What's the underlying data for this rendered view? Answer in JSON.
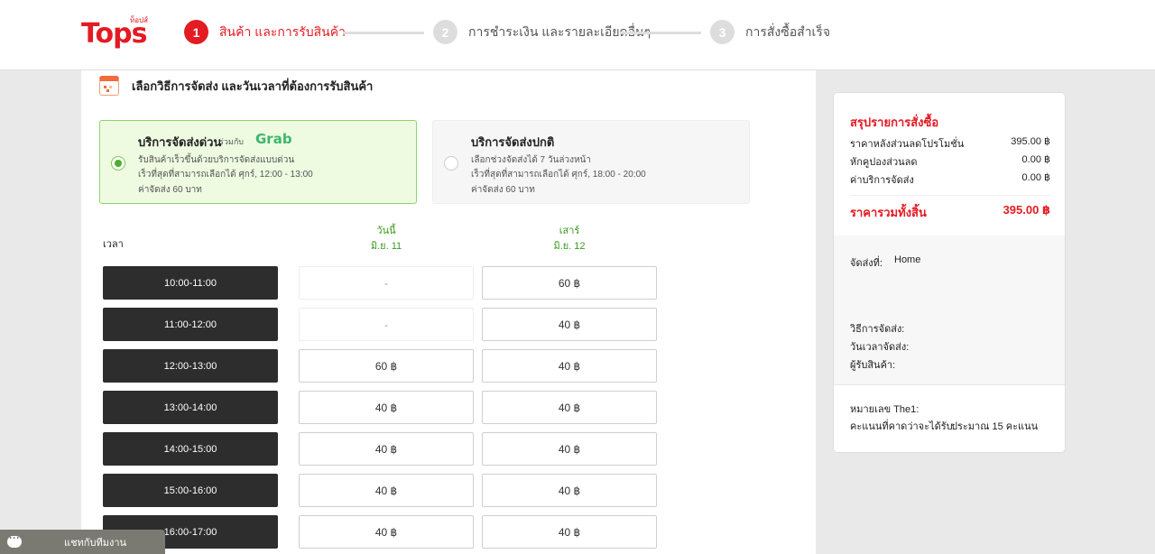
{
  "header": {
    "logo_text": "Tops",
    "logo_tagline": "ท็อปส์",
    "steps": [
      {
        "num": "1",
        "label": "สินค้า และการรับสินค้า"
      },
      {
        "num": "2",
        "label": "การชำระเงิน และรายละเอียดอื่นๆ"
      },
      {
        "num": "3",
        "label": "การสั่งซื้อสำเร็จ"
      }
    ]
  },
  "section_title": "เลือกวิธีการจัดส่ง และวันเวลาที่ต้องการรับสินค้า",
  "delivery_options": [
    {
      "title": "บริการจัดส่งด่วน",
      "partner_label": "ร่วมกับ",
      "partner_name": "Grab",
      "lines": [
        "รับสินค้าเร็วขึ้นด้วยบริการจัดส่งแบบด่วน",
        "เร็วที่สุดที่สามารถเลือกได้ ศุกร์, 12:00 - 13:00",
        "ค่าจัดส่ง 60 บาท"
      ],
      "selected": true
    },
    {
      "title": "บริการจัดส่งปกติ",
      "lines": [
        "เลือกช่วงจัดส่งได้ 7 วันล่วงหน้า",
        "เร็วที่สุดที่สามารถเลือกได้ ศุกร์, 18:00 - 20:00",
        "ค่าจัดส่ง 60 บาท"
      ],
      "selected": false
    }
  ],
  "schedule": {
    "time_header": "เวลา",
    "days": [
      {
        "name": "วันนี้",
        "date": "มิ.ย. 11"
      },
      {
        "name": "เสาร์",
        "date": "มิ.ย. 12"
      }
    ],
    "rows": [
      {
        "time": "10:00-11:00",
        "slots": [
          "-",
          "60 ฿"
        ]
      },
      {
        "time": "11:00-12:00",
        "slots": [
          "-",
          "40 ฿"
        ]
      },
      {
        "time": "12:00-13:00",
        "slots": [
          "60 ฿",
          "40 ฿"
        ]
      },
      {
        "time": "13:00-14:00",
        "slots": [
          "40 ฿",
          "40 ฿"
        ]
      },
      {
        "time": "14:00-15:00",
        "slots": [
          "40 ฿",
          "40 ฿"
        ]
      },
      {
        "time": "15:00-16:00",
        "slots": [
          "40 ฿",
          "40 ฿"
        ]
      },
      {
        "time": "16:00-17:00",
        "slots": [
          "40 ฿",
          "40 ฿"
        ]
      }
    ]
  },
  "summary": {
    "title": "สรุปรายการสั่งซื้อ",
    "rows": [
      {
        "label": "ราคาหลังส่วนลดโปรโมชั่น",
        "value": "395.00 ฿"
      },
      {
        "label": "หักคูปองส่วนลด",
        "value": "0.00 ฿"
      },
      {
        "label": "ค่าบริการจัดส่ง",
        "value": "0.00 ฿"
      }
    ],
    "total_label": "ราคารวมทั้งสิ้น",
    "total_value": "395.00 ฿",
    "ship_to_label": "จัดส่งที่:",
    "ship_to_value": "Home",
    "method_label": "วิธีการจัดส่ง:",
    "datetime_label": "วันเวลาจัดส่ง:",
    "receiver_label": "ผู้รับสินค้า:",
    "the1_label": "หมายเลข The1:",
    "points_label": "คะแนนที่คาดว่าจะได้รับ:",
    "points_value": "ประมาณ 15 คะแนน"
  },
  "chat": {
    "label": "แชทกับทีมงาน"
  },
  "colors": {
    "brand": "#e31b23",
    "grab": "#3fb56b",
    "selected_bg": "#eefbe1"
  }
}
